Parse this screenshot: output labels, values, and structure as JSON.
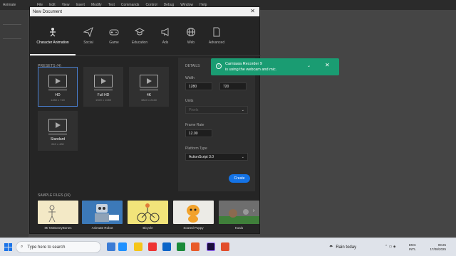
{
  "app": {
    "name": "Animate",
    "menus": [
      "File",
      "Edit",
      "View",
      "Insert",
      "Modify",
      "Text",
      "Commands",
      "Control",
      "Debug",
      "Window",
      "Help"
    ]
  },
  "dialog": {
    "title": "New Document",
    "categories": [
      {
        "label": "Character Animation",
        "icon": "character-icon",
        "active": true
      },
      {
        "label": "Social",
        "icon": "paper-plane-icon"
      },
      {
        "label": "Game",
        "icon": "gamepad-icon"
      },
      {
        "label": "Education",
        "icon": "graduation-cap-icon"
      },
      {
        "label": "Ads",
        "icon": "megaphone-icon"
      },
      {
        "label": "Web",
        "icon": "globe-icon"
      },
      {
        "label": "Advanced",
        "icon": "document-icon"
      }
    ],
    "presets_label": "PRESETS (4)",
    "presets": [
      {
        "name": "HD",
        "dims": "1280 x 720",
        "selected": true
      },
      {
        "name": "Full HD",
        "dims": "1920 x 1080"
      },
      {
        "name": "4K",
        "dims": "3840 x 2160"
      },
      {
        "name": "Standard",
        "dims": "640 x 480"
      }
    ],
    "details": {
      "heading": "DETAILS",
      "width_label": "Width",
      "width": "1280",
      "height": "720",
      "units_label": "Units",
      "units": "Pixels",
      "frame_rate_label": "Frame Rate",
      "frame_rate": "12.00",
      "platform_label": "Platform Type",
      "platform": "ActionScript 3.0",
      "create_label": "Create"
    },
    "samples_label": "SAMPLE FILES (16)",
    "samples": [
      {
        "name": "Mr McBoneyBones",
        "color": "#f3e9c6"
      },
      {
        "name": "Animate Robot",
        "color": "#3c79b8"
      },
      {
        "name": "Bicycle",
        "color": "#f2e47a"
      },
      {
        "name": "Scared Puppy",
        "color": "#ecebe6"
      },
      {
        "name": "Koalo",
        "color": "#6e6e6e"
      }
    ]
  },
  "toast": {
    "line1": "Camtasia Recorder 9",
    "line2": "is using the webcam and mic.",
    "color": "#1a9c72"
  },
  "taskbar": {
    "search_placeholder": "Type here to search",
    "weather": "Rain today",
    "lang1": "ENG",
    "lang2": "INTL",
    "time": "09:25",
    "date": "17/08/2025"
  }
}
